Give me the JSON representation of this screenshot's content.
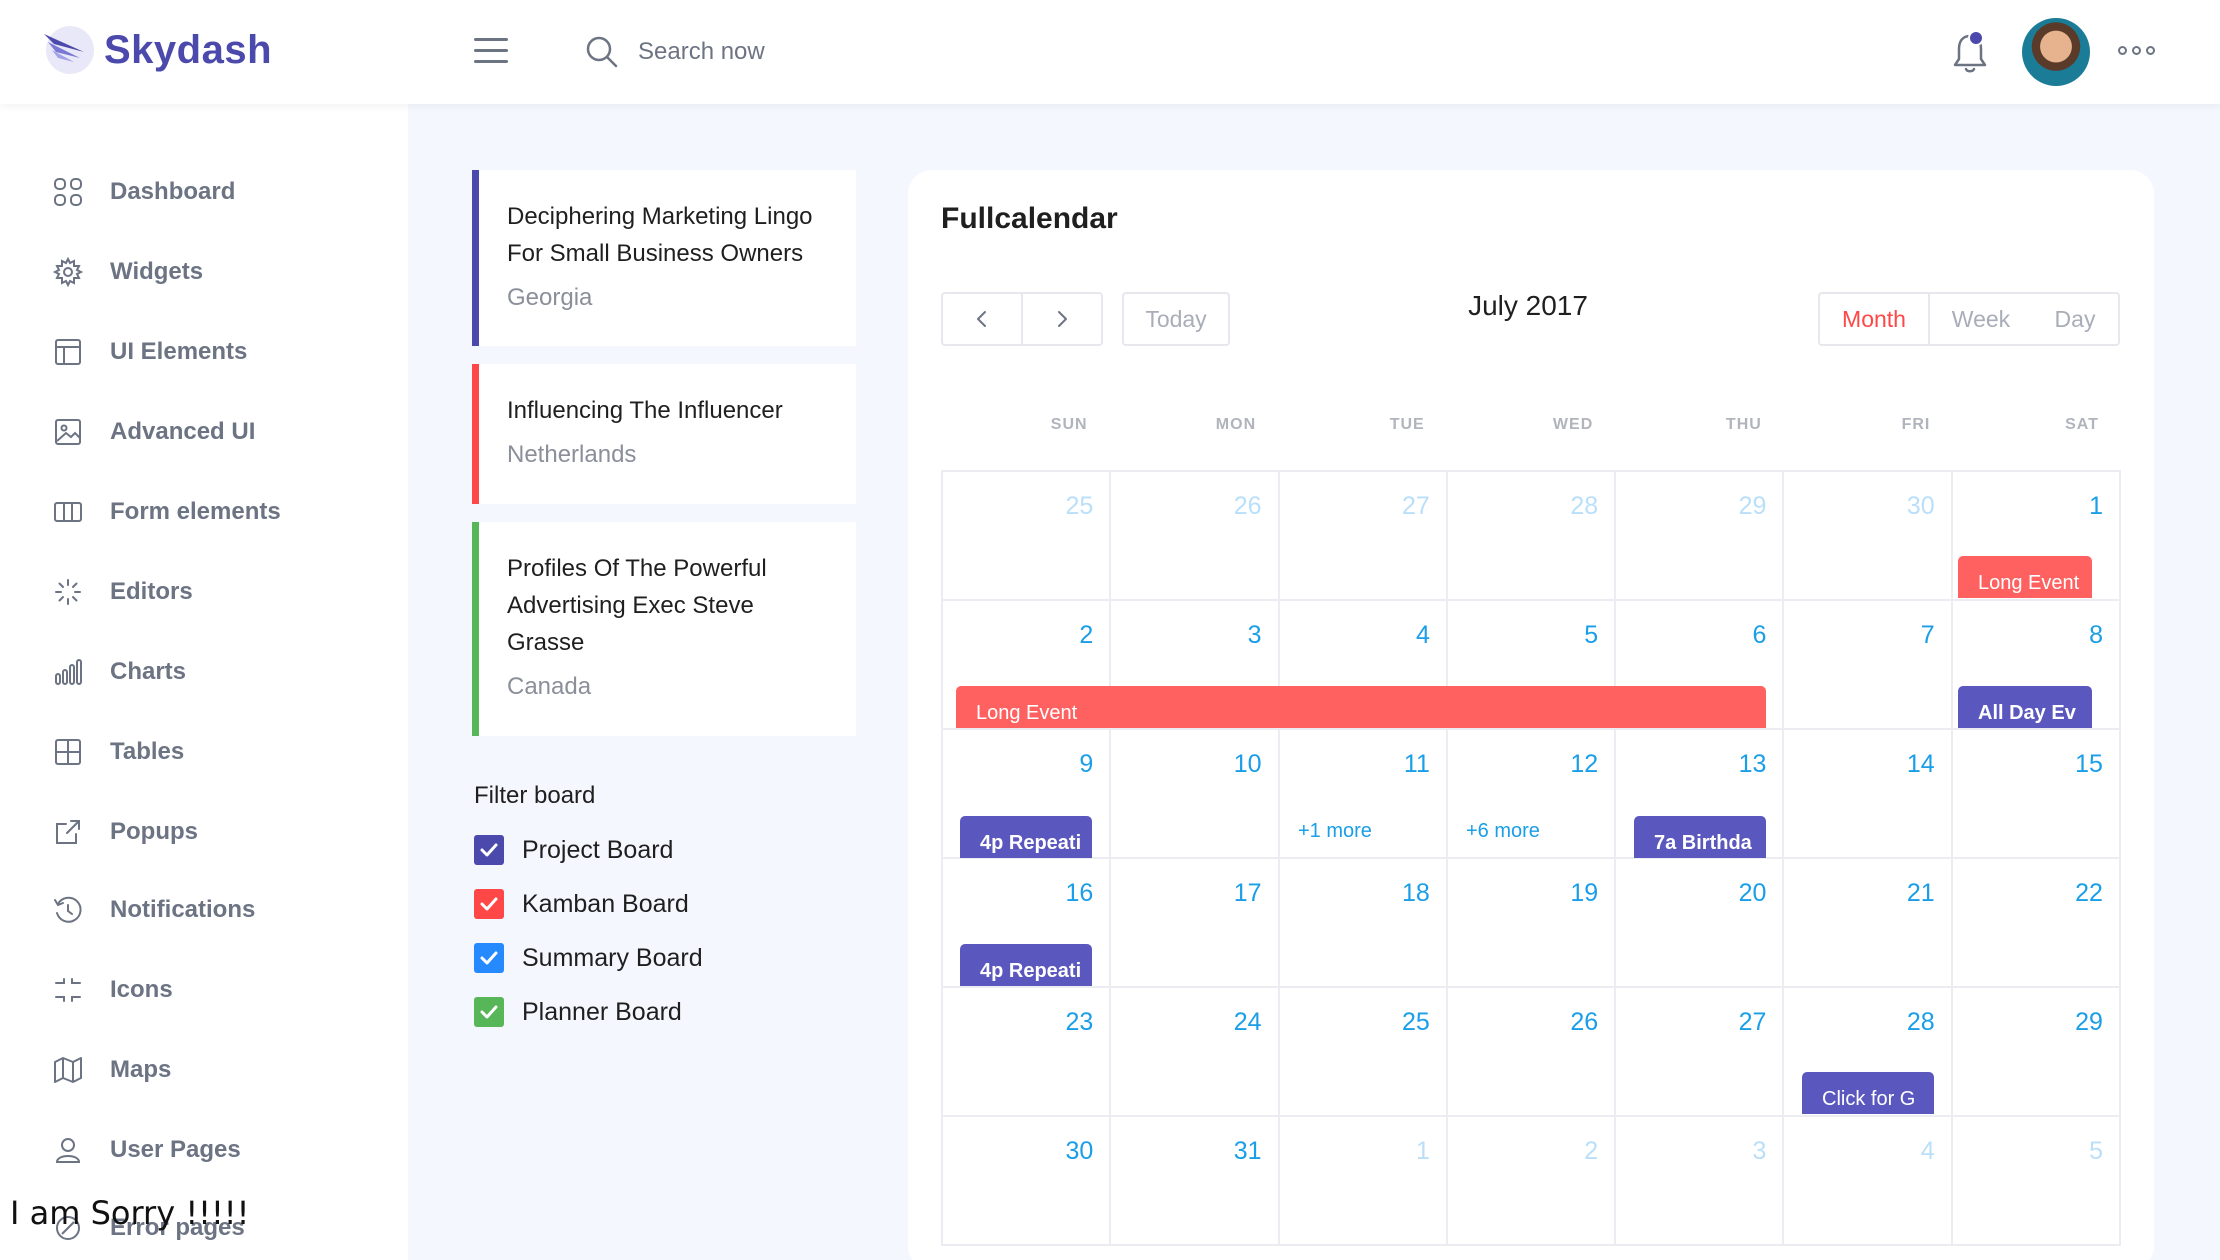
{
  "app": {
    "name": "Skydash"
  },
  "header": {
    "search_placeholder": "Search now"
  },
  "sidebar": {
    "items": [
      {
        "label": "Dashboard",
        "icon": "dashboard-icon"
      },
      {
        "label": "Widgets",
        "icon": "gear-icon"
      },
      {
        "label": "UI Elements",
        "icon": "layout-icon"
      },
      {
        "label": "Advanced UI",
        "icon": "image-icon"
      },
      {
        "label": "Form elements",
        "icon": "columns-icon"
      },
      {
        "label": "Editors",
        "icon": "loader-icon"
      },
      {
        "label": "Charts",
        "icon": "bar-chart-icon"
      },
      {
        "label": "Tables",
        "icon": "grid-icon"
      },
      {
        "label": "Popups",
        "icon": "external-link-icon"
      },
      {
        "label": "Notifications",
        "icon": "history-icon"
      },
      {
        "label": "Icons",
        "icon": "focus-icon"
      },
      {
        "label": "Maps",
        "icon": "map-icon"
      },
      {
        "label": "User Pages",
        "icon": "user-icon"
      },
      {
        "label": "Error pages",
        "icon": "error-icon"
      }
    ]
  },
  "overlay_text": "I am Sorry !!!!!",
  "events": [
    {
      "title_lines": [
        "Deciphering Marketing Lingo",
        "For Small Business Owners"
      ],
      "location": "Georgia",
      "color": "#4b49ac"
    },
    {
      "title_lines": [
        "Influencing The Influencer"
      ],
      "location": "Netherlands",
      "color": "#ff4747"
    },
    {
      "title_lines": [
        "Profiles Of The Powerful",
        "Advertising Exec Steve",
        "Grasse"
      ],
      "location": "Canada",
      "color": "#57b657"
    }
  ],
  "filter": {
    "title": "Filter board",
    "items": [
      {
        "label": "Project Board",
        "color": "#4b49ac",
        "checked": true
      },
      {
        "label": "Kamban Board",
        "color": "#ff4747",
        "checked": true
      },
      {
        "label": "Summary Board",
        "color": "#248afd",
        "checked": true
      },
      {
        "label": "Planner Board",
        "color": "#57b657",
        "checked": true
      }
    ]
  },
  "calendar": {
    "title": "Fullcalendar",
    "today_label": "Today",
    "month_title": "July 2017",
    "views": [
      "Month",
      "Week",
      "Day"
    ],
    "active_view": "Month",
    "dow": [
      "SUN",
      "MON",
      "TUE",
      "WED",
      "THU",
      "FRI",
      "SAT"
    ],
    "weeks": [
      [
        {
          "n": "25",
          "m": true
        },
        {
          "n": "26",
          "m": true
        },
        {
          "n": "27",
          "m": true
        },
        {
          "n": "28",
          "m": true
        },
        {
          "n": "29",
          "m": true
        },
        {
          "n": "30",
          "m": true
        },
        {
          "n": "1",
          "m": false
        }
      ],
      [
        {
          "n": "2",
          "m": false
        },
        {
          "n": "3",
          "m": false
        },
        {
          "n": "4",
          "m": false
        },
        {
          "n": "5",
          "m": false
        },
        {
          "n": "6",
          "m": false
        },
        {
          "n": "7",
          "m": false
        },
        {
          "n": "8",
          "m": false
        }
      ],
      [
        {
          "n": "9",
          "m": false
        },
        {
          "n": "10",
          "m": false
        },
        {
          "n": "11",
          "m": false
        },
        {
          "n": "12",
          "m": false
        },
        {
          "n": "13",
          "m": false
        },
        {
          "n": "14",
          "m": false
        },
        {
          "n": "15",
          "m": false
        }
      ],
      [
        {
          "n": "16",
          "m": false
        },
        {
          "n": "17",
          "m": false
        },
        {
          "n": "18",
          "m": false
        },
        {
          "n": "19",
          "m": false
        },
        {
          "n": "20",
          "m": false
        },
        {
          "n": "21",
          "m": false
        },
        {
          "n": "22",
          "m": false
        }
      ],
      [
        {
          "n": "23",
          "m": false
        },
        {
          "n": "24",
          "m": false
        },
        {
          "n": "25",
          "m": false
        },
        {
          "n": "26",
          "m": false
        },
        {
          "n": "27",
          "m": false
        },
        {
          "n": "28",
          "m": false
        },
        {
          "n": "29",
          "m": false
        }
      ],
      [
        {
          "n": "30",
          "m": false
        },
        {
          "n": "31",
          "m": false
        },
        {
          "n": "1",
          "m": true
        },
        {
          "n": "2",
          "m": true
        },
        {
          "n": "3",
          "m": true
        },
        {
          "n": "4",
          "m": true
        },
        {
          "n": "5",
          "m": true
        }
      ]
    ],
    "events": {
      "long_event_1": "Long Event",
      "long_event_2": "Long Event",
      "all_day": "All Day Ev",
      "repeat_1": "4p Repeati",
      "repeat_2": "4p Repeati",
      "birthday": "7a Birthda",
      "click_for": "Click for G",
      "more_1": "+1 more",
      "more_2": "+6 more"
    },
    "event_colors": {
      "red": "#ff6161",
      "purple": "#5a57bf"
    }
  }
}
